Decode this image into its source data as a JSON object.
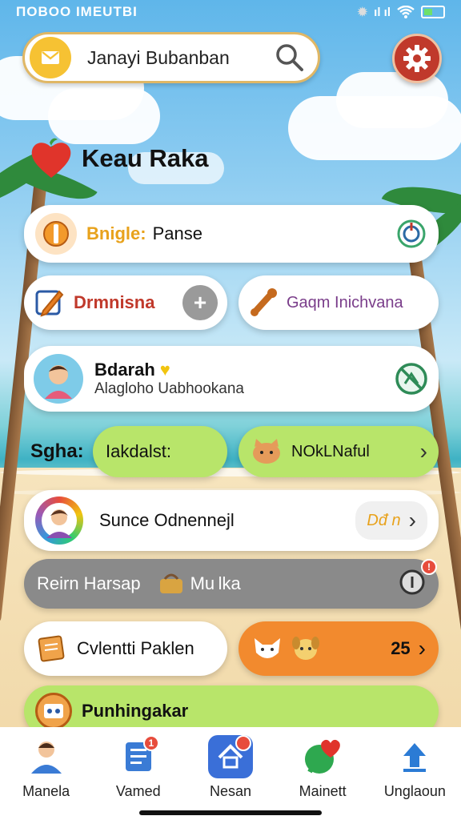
{
  "status_bar": {
    "left_text": "ΠΟΒΟΟ IMEUTBI",
    "right_text": "ıl ıl"
  },
  "search": {
    "label": "Janayi Bubanban"
  },
  "section": {
    "title": "Keau Raka"
  },
  "cards": {
    "bingle": {
      "label": "Bnigle:",
      "sub": "Panse"
    },
    "drm": {
      "label": "Drmnisna"
    },
    "gaqm": {
      "label": "Gaqm Inichvana"
    },
    "profile": {
      "title": "Bdarah",
      "subtitle": "Alagloho Uabhookana"
    },
    "sgha": {
      "label": "Sgha:",
      "pill": "Iakdalst:"
    },
    "nokl": {
      "label": "NOkLNaful"
    },
    "sunce": {
      "label": "Sunce Odnennejl",
      "badge": "Dđ n"
    },
    "reim": {
      "label": "Reirn Harsap",
      "suffix": "Mu lka"
    },
    "avlenth": {
      "label": "Cvlentti Paklen"
    },
    "count": {
      "value": "25"
    },
    "punh": {
      "label": "Punhingakar"
    }
  },
  "nav": [
    {
      "label": "Manela"
    },
    {
      "label": "Vamed",
      "badge": "1"
    },
    {
      "label": "Nesan",
      "badge": ""
    },
    {
      "label": "Mainett"
    },
    {
      "label": "Unglaoun"
    }
  ],
  "colors": {
    "accent_red": "#c0392b",
    "green_pill": "#b8e56a",
    "orange_pill": "#f28a2e",
    "gray_bar": "#8a8a8a"
  }
}
